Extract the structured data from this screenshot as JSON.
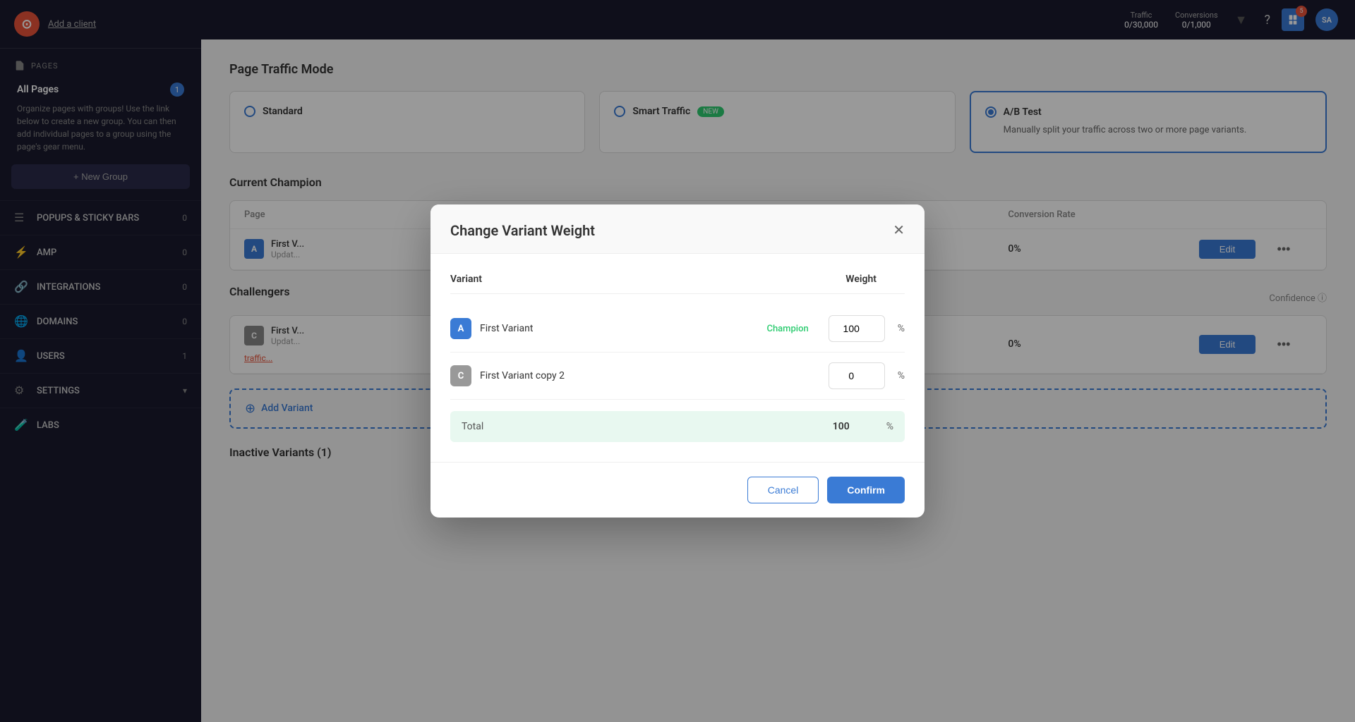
{
  "app": {
    "logo": "⊙",
    "add_client_label": "Add a client"
  },
  "topbar": {
    "traffic_label": "Traffic",
    "traffic_value": "0/30,000",
    "conversions_label": "Conversions",
    "conversions_value": "0/1,000",
    "help_icon": "?",
    "notification_count": "5",
    "avatar_initials": "SA"
  },
  "sidebar": {
    "pages_icon": "📄",
    "pages_label": "PAGES",
    "all_pages_label": "All Pages",
    "all_pages_count": "1",
    "hint_text": "Organize pages with groups! Use the link below to create a new group. You can then add individual pages to a group using the page's gear menu.",
    "new_group_label": "+ New Group",
    "nav_items": [
      {
        "icon": "☰",
        "label": "POPUPS & STICKY BARS",
        "count": "0"
      },
      {
        "icon": "⚡",
        "label": "AMP",
        "count": "0"
      },
      {
        "icon": "🔗",
        "label": "INTEGRATIONS",
        "count": "0"
      },
      {
        "icon": "🌐",
        "label": "DOMAINS",
        "count": "0"
      },
      {
        "icon": "👤",
        "label": "USERS",
        "count": "1"
      },
      {
        "icon": "⚙",
        "label": "SETTINGS",
        "count": ""
      },
      {
        "icon": "🧪",
        "label": "LABS",
        "count": ""
      }
    ]
  },
  "page": {
    "traffic_mode_title": "Page Traffic Mode",
    "traffic_cards": [
      {
        "label": "Standard",
        "selected": false
      },
      {
        "label": "Smart Traffic",
        "badge": "NEW",
        "selected": false
      },
      {
        "label": "A/B Test",
        "selected": true,
        "description": "Manually split your traffic across two or more page variants."
      }
    ],
    "current_champion_section": "Current Ch...",
    "conversion_rate_label": "Conversion Rate",
    "champion_row": {
      "letter": "A",
      "name": "First V...",
      "updated": "Updat...",
      "rate": "0%"
    },
    "challengers_section": "Challenger...",
    "confidence_label": "Confidence",
    "challenger_row": {
      "letter": "C",
      "name": "First V...",
      "updated": "Updat...",
      "traffic_link": "traffic...",
      "rate": "0%"
    },
    "add_variant_label": "Add Variant",
    "inactive_title": "Inactive Variants (1)"
  },
  "modal": {
    "title": "Change Variant Weight",
    "variant_col": "Variant",
    "weight_col": "Weight",
    "variants": [
      {
        "letter": "A",
        "name": "First Variant",
        "champion": "Champion",
        "weight": "100",
        "type": "champion"
      },
      {
        "letter": "C",
        "name": "First Variant copy 2",
        "champion": "",
        "weight": "0",
        "type": "copy"
      }
    ],
    "total_label": "Total",
    "total_value": "100",
    "total_percent": "%",
    "cancel_label": "Cancel",
    "confirm_label": "Confirm"
  }
}
